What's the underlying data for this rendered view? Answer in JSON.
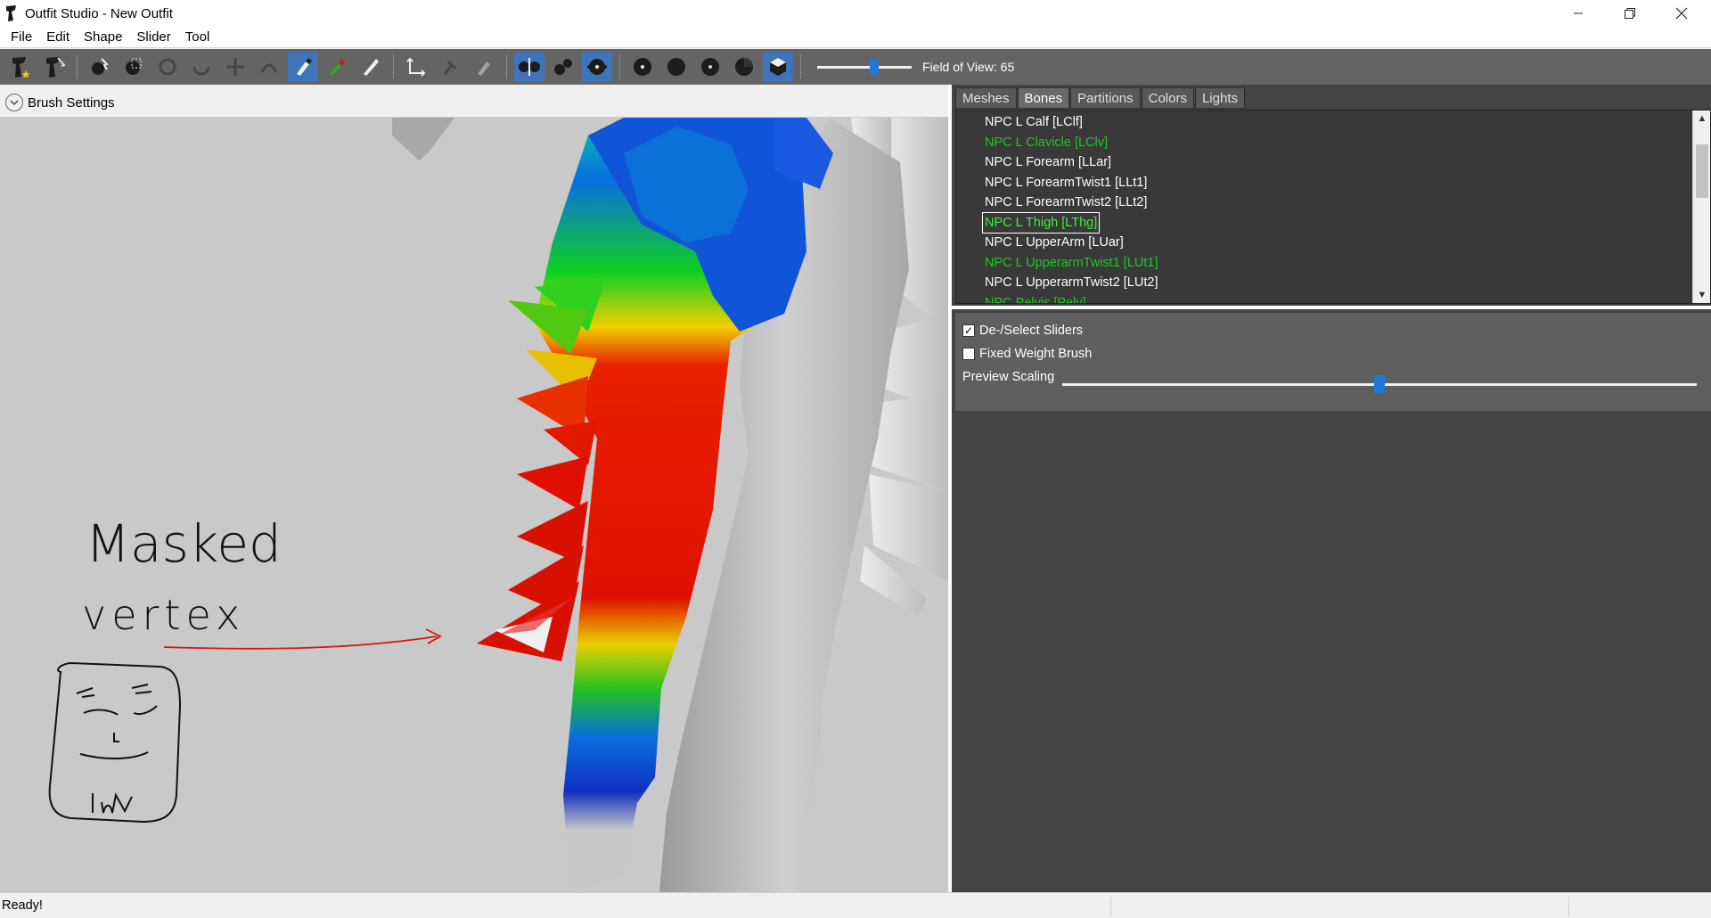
{
  "window": {
    "title": "Outfit Studio - New Outfit",
    "controls": [
      "minimize",
      "restore",
      "close"
    ]
  },
  "menu": {
    "items": [
      "File",
      "Edit",
      "Shape",
      "Slider",
      "Tool"
    ]
  },
  "toolbar": {
    "fov_label": "Field of View: 65",
    "fov_value": 65,
    "accent": "#1e7ad6",
    "active_tool": "weight-brush"
  },
  "brush_settings": {
    "label": "Brush Settings"
  },
  "viewport": {
    "annotation_line1": "Masked",
    "annotation_line2": "vertex",
    "annotation_color": "#d81414",
    "doodle_text": "lhn"
  },
  "right_panel": {
    "tabs": [
      "Meshes",
      "Bones",
      "Partitions",
      "Colors",
      "Lights"
    ],
    "active_tab": "Bones",
    "bones": [
      {
        "name": "NPC L Calf [LClf]",
        "state": "normal"
      },
      {
        "name": "NPC L Clavicle [LClv]",
        "state": "green"
      },
      {
        "name": "NPC L Forearm [LLar]",
        "state": "normal"
      },
      {
        "name": "NPC L ForearmTwist1 [LLt1]",
        "state": "normal"
      },
      {
        "name": "NPC L ForearmTwist2 [LLt2]",
        "state": "normal"
      },
      {
        "name": "NPC L Thigh [LThg]",
        "state": "selected"
      },
      {
        "name": "NPC L UpperArm [LUar]",
        "state": "normal"
      },
      {
        "name": "NPC L UpperarmTwist1 [LUt1]",
        "state": "green"
      },
      {
        "name": "NPC L UpperarmTwist2 [LUt2]",
        "state": "normal"
      },
      {
        "name": "NPC Pelvis [Pelv]",
        "state": "green"
      }
    ],
    "options": {
      "deselect_sliders": {
        "label": "De-/Select Sliders",
        "checked": true
      },
      "fixed_weight_brush": {
        "label": "Fixed Weight Brush",
        "checked": false
      },
      "preview_scaling": {
        "label": "Preview Scaling",
        "value": 0.5
      }
    }
  },
  "status": {
    "text": "Ready!"
  }
}
